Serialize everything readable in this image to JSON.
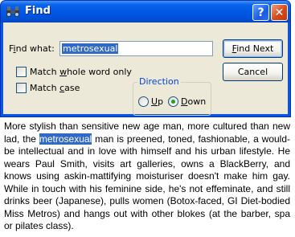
{
  "dialog": {
    "title": "Find",
    "find_label": "Find what:",
    "find_value": "metrosexual",
    "find_next_label": "Find Next",
    "cancel_label": "Cancel",
    "match_whole_word_label": "Match whole word only",
    "match_whole_word_checked": false,
    "match_case_label": "Match case",
    "match_case_checked": false,
    "direction_label": "Direction",
    "up_label": "Up",
    "down_label": "Down",
    "direction_selected": "Down",
    "help_icon": "help-question-icon",
    "close_icon": "close-x-icon"
  },
  "document": {
    "before": "More stylish than sensitive new age man, more cultured than new lad, the ",
    "highlight": "metrosexual",
    "after": " man is preened, toned, fashionable, a would-be intellectual and in love with himself and his urban lifestyle. He wears Paul Smith, visits art galleries, owns a BlackBerry, and knows using askin-mattifying moisturiser doesn't make him gay. While in touch with his feminine side, he's not effeminate, and still drinks beer (Japanese), pulls women (Botox-faced, GI Diet-bodied Miss Metros) and hangs out with other blokes (at the barber, spa or pilates class)."
  }
}
